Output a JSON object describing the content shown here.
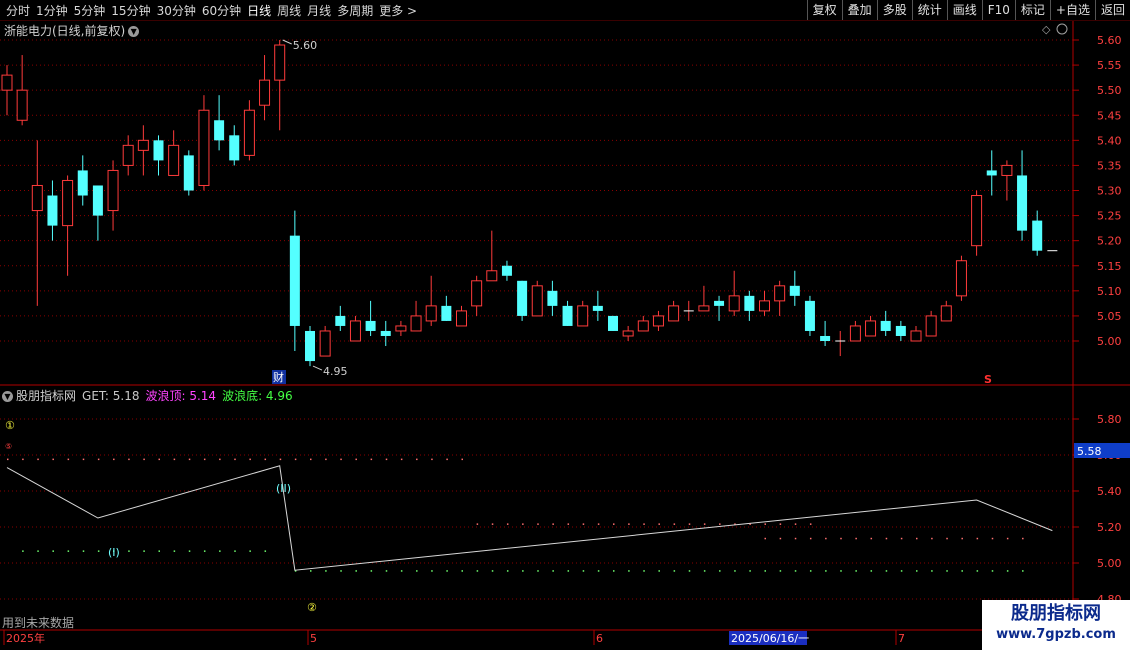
{
  "toolbar": {
    "periods": [
      "分时",
      "1分钟",
      "5分钟",
      "15分钟",
      "30分钟",
      "60分钟",
      "日线",
      "周线",
      "月线",
      "多周期",
      "更多 >"
    ],
    "active_period": "日线",
    "buttons": [
      "复权",
      "叠加",
      "多股",
      "统计",
      "画线",
      "F10",
      "标记",
      "+自选",
      "返回"
    ]
  },
  "stock": {
    "title": "浙能电力(日线,前复权)",
    "diamond_icon": "diamond-icon"
  },
  "indicator": {
    "name": "股朋指标网",
    "get_label": "GET: 5.18",
    "top_label": "波浪顶: 5.14",
    "bottom_label": "波浪底: 4.96",
    "wave_labels": [
      "(I)",
      "(II)"
    ],
    "circle_marks": [
      "①",
      "②",
      "⑤"
    ],
    "current_value": "5.58"
  },
  "status": {
    "future_data": "用到未来数据",
    "date_box": "2025/06/16/一",
    "time_labels": [
      "2025年",
      "5",
      "6",
      "7"
    ]
  },
  "annotations": {
    "high": "5.60",
    "low": "4.95",
    "cai": "财",
    "s_mark": "S"
  },
  "watermark": {
    "line1": "股朋指标网",
    "line2": "www.7gpzb.com"
  },
  "colors": {
    "up": "#ff3b3b",
    "down": "#54ffff",
    "grid": "#8a0000",
    "axis": "#b00000",
    "line": "#d8d8d8"
  },
  "chart_data": {
    "type": "candlestick",
    "ylim_price": [
      4.93,
      5.63
    ],
    "price_ticks": [
      "5.60",
      "5.55",
      "5.50",
      "5.45",
      "5.40",
      "5.35",
      "5.30",
      "5.25",
      "5.20",
      "5.15",
      "5.10",
      "5.05",
      "5.00"
    ],
    "ylim_indicator": [
      4.89,
      5.9
    ],
    "indicator_ticks": [
      "5.80",
      "5.60",
      "5.40",
      "5.20",
      "5.00",
      "4.80"
    ],
    "candles": [
      [
        5.5,
        5.53,
        5.45,
        5.55
      ],
      [
        5.44,
        5.5,
        5.43,
        5.57
      ],
      [
        5.26,
        5.31,
        5.07,
        5.4
      ],
      [
        5.29,
        5.23,
        5.2,
        5.32
      ],
      [
        5.23,
        5.32,
        5.13,
        5.33
      ],
      [
        5.34,
        5.29,
        5.27,
        5.37
      ],
      [
        5.31,
        5.25,
        5.2,
        5.31
      ],
      [
        5.26,
        5.34,
        5.22,
        5.36
      ],
      [
        5.35,
        5.39,
        5.33,
        5.41
      ],
      [
        5.38,
        5.4,
        5.33,
        5.43
      ],
      [
        5.4,
        5.36,
        5.33,
        5.41
      ],
      [
        5.33,
        5.39,
        5.35,
        5.42
      ],
      [
        5.37,
        5.3,
        5.29,
        5.38
      ],
      [
        5.31,
        5.46,
        5.3,
        5.49
      ],
      [
        5.44,
        5.4,
        5.38,
        5.49
      ],
      [
        5.41,
        5.36,
        5.35,
        5.43
      ],
      [
        5.37,
        5.46,
        5.36,
        5.48
      ],
      [
        5.47,
        5.52,
        5.44,
        5.57
      ],
      [
        5.52,
        5.59,
        5.42,
        5.6
      ],
      [
        5.21,
        5.03,
        4.98,
        5.26
      ],
      [
        5.02,
        4.96,
        4.95,
        5.03
      ],
      [
        4.97,
        5.02,
        4.97,
        5.03
      ],
      [
        5.05,
        5.03,
        5.02,
        5.07
      ],
      [
        5.0,
        5.04,
        5.0,
        5.05
      ],
      [
        5.04,
        5.02,
        5.01,
        5.08
      ],
      [
        5.02,
        5.01,
        4.99,
        5.04
      ],
      [
        5.02,
        5.03,
        5.01,
        5.04
      ],
      [
        5.02,
        5.05,
        5.02,
        5.08
      ],
      [
        5.04,
        5.07,
        5.03,
        5.13
      ],
      [
        5.07,
        5.04,
        5.04,
        5.09
      ],
      [
        5.03,
        5.06,
        5.04,
        5.07
      ],
      [
        5.07,
        5.12,
        5.05,
        5.13
      ],
      [
        5.12,
        5.14,
        5.12,
        5.22
      ],
      [
        5.15,
        5.13,
        5.12,
        5.16
      ],
      [
        5.12,
        5.05,
        5.04,
        5.12
      ],
      [
        5.05,
        5.11,
        5.05,
        5.12
      ],
      [
        5.1,
        5.07,
        5.05,
        5.12
      ],
      [
        5.07,
        5.03,
        5.03,
        5.08
      ],
      [
        5.03,
        5.07,
        5.03,
        5.08
      ],
      [
        5.07,
        5.06,
        5.04,
        5.1
      ],
      [
        5.05,
        5.02,
        5.02,
        5.05
      ],
      [
        5.01,
        5.02,
        5.0,
        5.03
      ],
      [
        5.02,
        5.04,
        5.02,
        5.05
      ],
      [
        5.03,
        5.05,
        5.02,
        5.06
      ],
      [
        5.04,
        5.07,
        5.04,
        5.08
      ],
      [
        5.06,
        5.06,
        5.04,
        5.08
      ],
      [
        5.06,
        5.07,
        5.06,
        5.11
      ],
      [
        5.08,
        5.07,
        5.04,
        5.09
      ],
      [
        5.06,
        5.09,
        5.05,
        5.14
      ],
      [
        5.09,
        5.06,
        5.04,
        5.1
      ],
      [
        5.06,
        5.08,
        5.05,
        5.1
      ],
      [
        5.08,
        5.11,
        5.05,
        5.12
      ],
      [
        5.11,
        5.09,
        5.07,
        5.14
      ],
      [
        5.08,
        5.02,
        5.01,
        5.09
      ],
      [
        5.01,
        5.0,
        4.99,
        5.04
      ],
      [
        5.0,
        5.0,
        4.97,
        5.02
      ],
      [
        5.0,
        5.03,
        5.0,
        5.04
      ],
      [
        5.01,
        5.04,
        5.01,
        5.05
      ],
      [
        5.04,
        5.02,
        5.01,
        5.06
      ],
      [
        5.03,
        5.01,
        5.0,
        5.04
      ],
      [
        5.0,
        5.02,
        5.0,
        5.03
      ],
      [
        5.01,
        5.05,
        5.01,
        5.06
      ],
      [
        5.04,
        5.07,
        5.04,
        5.08
      ],
      [
        5.09,
        5.16,
        5.08,
        5.17
      ],
      [
        5.19,
        5.29,
        5.17,
        5.3
      ],
      [
        5.34,
        5.33,
        5.29,
        5.38
      ],
      [
        5.33,
        5.35,
        5.28,
        5.36
      ],
      [
        5.33,
        5.22,
        5.2,
        5.38
      ],
      [
        5.24,
        5.18,
        5.17,
        5.26
      ],
      [
        5.18,
        5.18,
        5.18,
        5.18
      ]
    ],
    "wave_line": [
      [
        5.53,
        0
      ],
      [
        5.25,
        6
      ],
      [
        5.54,
        18
      ],
      [
        4.96,
        19
      ],
      [
        5.35,
        64
      ],
      [
        5.18,
        69
      ]
    ],
    "dotted_top": 5.58,
    "dotted_mid": 5.22,
    "dotted_low": 5.14,
    "dotted_i": 5.07,
    "dotted_bot": 4.96
  }
}
